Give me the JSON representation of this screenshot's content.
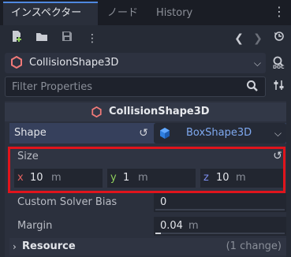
{
  "tabs": [
    {
      "label": "インスペクター",
      "active": true
    },
    {
      "label": "ノード",
      "active": false
    },
    {
      "label": "History",
      "active": false
    }
  ],
  "toolbar": {
    "icons": [
      "new-resource-icon",
      "open-folder-icon",
      "save-icon",
      "more-options-icon",
      "history-back-icon",
      "history-forward-icon",
      "object-history-icon"
    ]
  },
  "node_select": {
    "value": "CollisionShape3D"
  },
  "filter": {
    "placeholder": "Filter Properties"
  },
  "section": {
    "title": "CollisionShape3D"
  },
  "shape": {
    "label": "Shape",
    "value": "BoxShape3D"
  },
  "size": {
    "label": "Size",
    "x": {
      "axis": "x",
      "value": "10",
      "unit": "m"
    },
    "y": {
      "axis": "y",
      "value": "1",
      "unit": "m"
    },
    "z": {
      "axis": "z",
      "value": "10",
      "unit": "m"
    }
  },
  "custom_solver_bias": {
    "label": "Custom Solver Bias",
    "value": "0",
    "level": 0
  },
  "margin": {
    "label": "Margin",
    "value": "0.04",
    "unit": "m",
    "level": 0.04
  },
  "resource": {
    "label": "Resource",
    "note": "(1 change)"
  },
  "colors": {
    "accent": "#4f88e0",
    "highlight": "#e0141c",
    "axis_x": "#e0605e",
    "axis_y": "#8fd05c",
    "axis_z": "#7c8ef0"
  }
}
